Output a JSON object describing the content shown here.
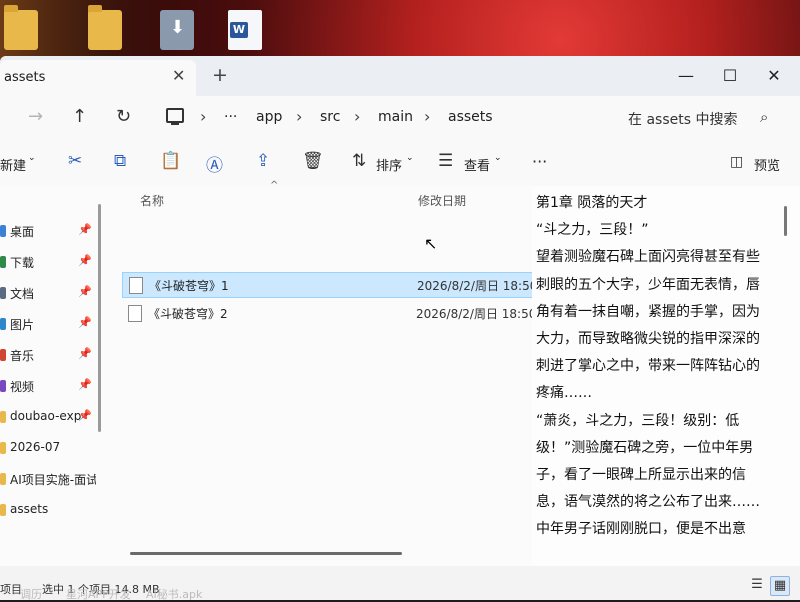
{
  "desktop": {
    "icons": [
      {
        "name": "folder-icon"
      },
      {
        "name": "folder-icon"
      },
      {
        "name": "download-icon"
      },
      {
        "name": "word-document-icon"
      }
    ]
  },
  "window": {
    "tab_title": "assets",
    "tab_close": "✕",
    "new_tab": "+",
    "minimize": "—",
    "maximize": "☐",
    "close": "✕"
  },
  "addressbar": {
    "back": "←",
    "forward": "→",
    "up": "↑",
    "refresh": "↻",
    "ellipsis": "···",
    "breadcrumbs": [
      "app",
      "src",
      "main",
      "assets"
    ],
    "search_placeholder": "在 assets 中搜索",
    "search_icon": "⌕"
  },
  "toolbar": {
    "new_label": "新建",
    "sort_label": "排序",
    "view_label": "查看",
    "more": "···",
    "preview_label": "预览"
  },
  "sidebar": {
    "items": [
      {
        "label": "桌面",
        "color": "#3b82d6",
        "pinned": true
      },
      {
        "label": "下载",
        "color": "#2f8a4a",
        "pinned": true
      },
      {
        "label": "文档",
        "color": "#5a6b82",
        "pinned": true
      },
      {
        "label": "图片",
        "color": "#2f86c9",
        "pinned": true
      },
      {
        "label": "音乐",
        "color": "#d0452f",
        "pinned": true
      },
      {
        "label": "视频",
        "color": "#7a46c2",
        "pinned": true
      },
      {
        "label": "doubao-exp",
        "color": "#e8b94a",
        "pinned": true
      },
      {
        "label": "2026-07",
        "color": "#e8b94a",
        "pinned": false
      },
      {
        "label": "AI项目实施-面试",
        "color": "#e8b94a",
        "pinned": false
      },
      {
        "label": "assets",
        "color": "#e8b94a",
        "pinned": false
      }
    ],
    "pin_glyph": "📌"
  },
  "filelist": {
    "col_name": "名称",
    "col_date": "修改日期",
    "sort_indicator": "^",
    "files": [
      {
        "name": "《斗破苍穹》1",
        "date": "2026/8/2/周日 18:50",
        "selected": true
      },
      {
        "name": "《斗破苍穹》2",
        "date": "2026/8/2/周日 18:50",
        "selected": false
      }
    ]
  },
  "preview": {
    "paragraphs": [
      "第1章 陨落的天才",
      "“斗之力，三段！”",
      "望着测验魔石碑上面闪亮得甚至有些刺眼的五个大字，少年面无表情，唇角有着一抹自嘲，紧握的手掌，因为大力，而导致略微尖锐的指甲深深的刺进了掌心之中，带来一阵阵钻心的疼痛……",
      "“萧炎，斗之力，三段！级别：低级！”测验魔石碑之旁，一位中年男子，看了一眼碑上所显示出来的信息，语气漠然的将之公布了出来……",
      "中年男子话刚刚脱口，便是不出意"
    ]
  },
  "status": {
    "item_count": "项目",
    "selection": "选中 1 个项目  14.8 MB"
  },
  "taskbar": {
    "items": [
      "调历",
      "星河APP开发",
      "AI秘书.apk"
    ]
  }
}
